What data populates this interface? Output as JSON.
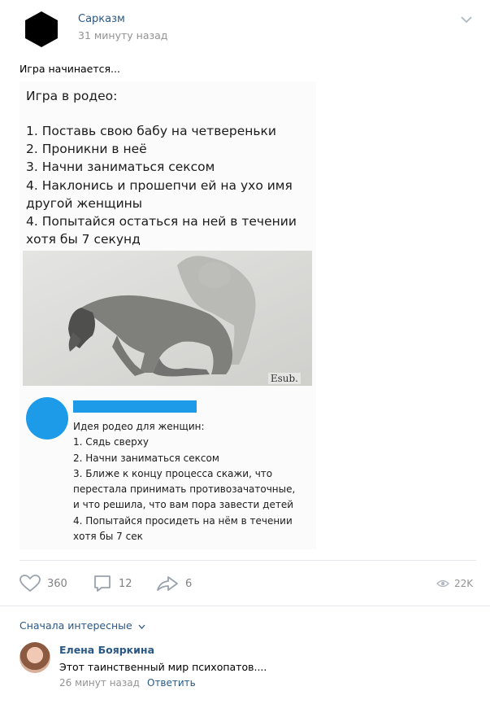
{
  "post": {
    "author": "Сарказм",
    "time": "31 минуту назад",
    "text": "Игра начинается..."
  },
  "meme": {
    "title": "Игра в родео:",
    "rules": [
      "1. Поставь свою бабу на четвереньки",
      "2. Проникни в неё",
      "3. Начни заниматься сексом",
      "4. Наклонись и прошепчи ей на ухо имя",
      "другой женщины",
      "4. Попытайся остаться на ней в течении",
      "хотя бы 7 секунд"
    ],
    "photo_signature": "Esub.",
    "reply_title": "Идея родео для женщин:",
    "reply_lines": [
      "1. Сядь сверху",
      "2. Начни заниматься сексом",
      "3. Ближе к концу процесса скажи, что",
      "перестала принимать противозачаточные,",
      "и что решила, что вам пора завести детей",
      "4. Попытайся просидеть на нём в течении",
      "хотя бы 7 сек"
    ]
  },
  "actions": {
    "likes": "360",
    "comments": "12",
    "shares": "6",
    "views": "22K"
  },
  "comments_section": {
    "sort_label": "Сначала интересные",
    "items": [
      {
        "author": "Елена Бояркина",
        "text": "Этот таинственный мир психопатов....",
        "time": "26 минут назад",
        "reply_label": "Ответить"
      }
    ]
  },
  "colors": {
    "link": "#2a5885",
    "muted": "#939393",
    "twitter_blue": "#1d9be8"
  }
}
